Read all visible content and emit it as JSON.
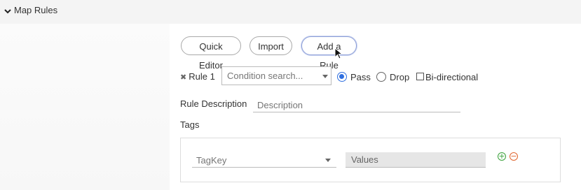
{
  "section": {
    "title": "Map Rules",
    "collapse_icon": "chevron-down-icon"
  },
  "toolbar": {
    "quick_editor_label": "Quick Editor",
    "import_label": "Import",
    "add_rule_label": "Add a Rule"
  },
  "rule": {
    "remove_icon": "close-icon",
    "label": "Rule 1",
    "condition_placeholder": "Condition search...",
    "pass_label": "Pass",
    "drop_label": "Drop",
    "bidirectional_label": "Bi-directional",
    "selected_action": "Pass",
    "bidirectional_checked": false
  },
  "description": {
    "label": "Rule Description",
    "placeholder": "Description"
  },
  "tags": {
    "label": "Tags",
    "tagkey_placeholder": "TagKey",
    "values_placeholder": "Values",
    "add_icon": "plus-circle-icon",
    "remove_icon": "minus-circle-icon"
  },
  "colors": {
    "radio_selected": "#2f6fe0",
    "add": "#3aa13a",
    "remove": "#e0652d",
    "header_bg": "#f4f4f4"
  }
}
